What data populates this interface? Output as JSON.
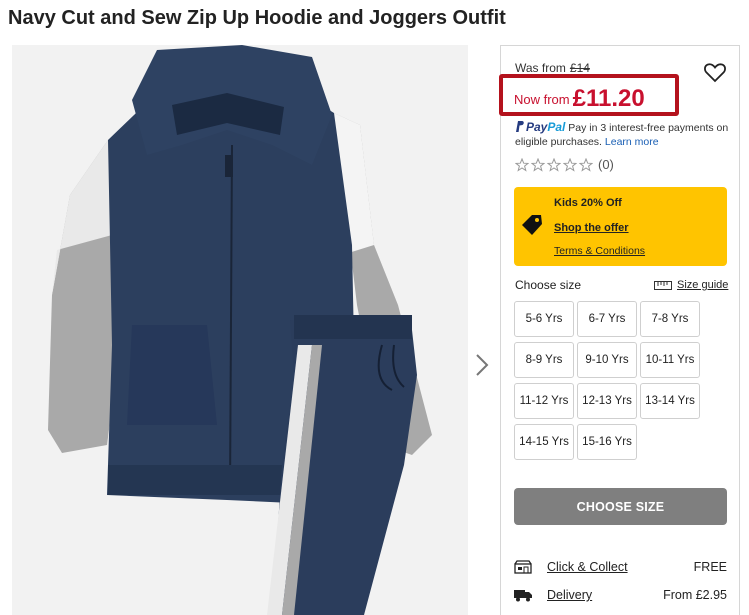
{
  "product": {
    "title": "Navy Cut and Sew Zip Up Hoodie and Joggers Outfit"
  },
  "pricing": {
    "was_label": "Was from",
    "was_price": "£14",
    "now_label": "Now from",
    "now_price": "£11.20",
    "accent_color": "#c8102e"
  },
  "paypal": {
    "logo_pay": "Pay",
    "logo_pal": "Pal",
    "text": "Pay in 3 interest-free payments on eligible purchases.",
    "link": "Learn more"
  },
  "rating": {
    "count": "(0)"
  },
  "offer": {
    "title": "Kids 20% Off",
    "shop_link": "Shop the offer",
    "terms_link": "Terms & Conditions",
    "bg_color": "#ffc400"
  },
  "sizes": {
    "label": "Choose size",
    "guide": "Size guide",
    "options": [
      "5-6 Yrs",
      "6-7 Yrs",
      "7-8 Yrs",
      "8-9 Yrs",
      "9-10 Yrs",
      "10-11 Yrs",
      "11-12 Yrs",
      "12-13 Yrs",
      "13-14 Yrs",
      "14-15 Yrs",
      "15-16 Yrs"
    ]
  },
  "cta": {
    "label": "CHOOSE SIZE"
  },
  "delivery": {
    "click_collect_label": "Click & Collect",
    "click_collect_price": "FREE",
    "delivery_label": "Delivery",
    "delivery_price": "From £2.95"
  },
  "icons": {
    "heart": "heart-icon",
    "next": "chevron-right-icon",
    "tag": "tag-icon",
    "ruler": "ruler-icon",
    "store": "store-icon",
    "truck": "truck-icon"
  }
}
